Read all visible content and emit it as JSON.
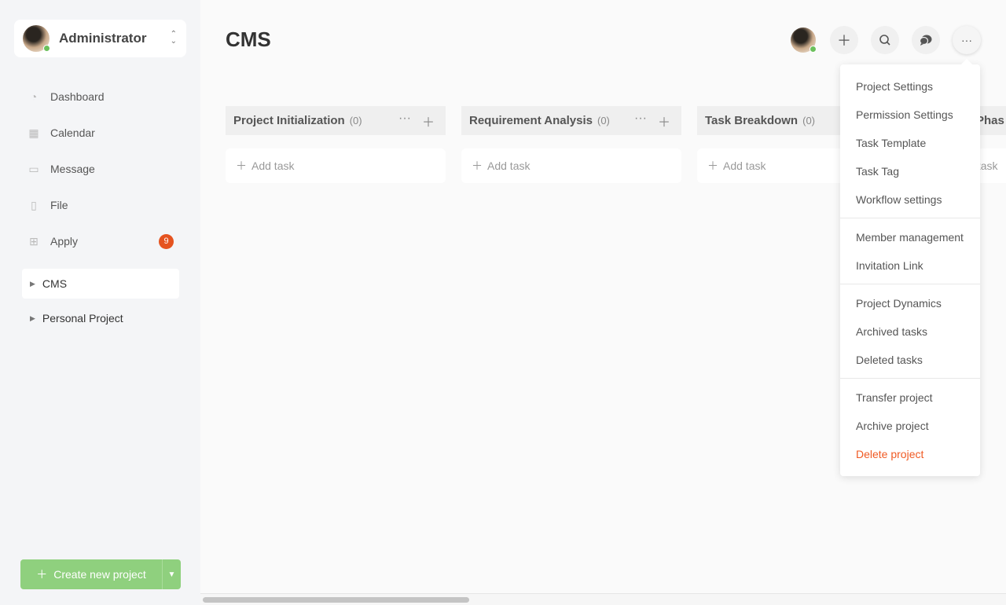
{
  "user": {
    "name": "Administrator",
    "status_color": "#6cc05c"
  },
  "nav": [
    {
      "label": "Dashboard",
      "icon": "dashboard-icon"
    },
    {
      "label": "Calendar",
      "icon": "calendar-icon"
    },
    {
      "label": "Message",
      "icon": "message-icon"
    },
    {
      "label": "File",
      "icon": "file-icon"
    },
    {
      "label": "Apply",
      "icon": "apps-icon",
      "badge": "9"
    }
  ],
  "projects": [
    {
      "label": "CMS",
      "active": true
    },
    {
      "label": "Personal Project",
      "active": false
    }
  ],
  "create_label": "Create new project",
  "page_title": "CMS",
  "columns": [
    {
      "title": "Project Initialization",
      "count": "(0)",
      "add": "Add task"
    },
    {
      "title": "Requirement Analysis",
      "count": "(0)",
      "add": "Add task"
    },
    {
      "title": "Task Breakdown",
      "count": "(0)",
      "add": "Add task"
    },
    {
      "title": "Phas",
      "count": "",
      "add": "Add task"
    }
  ],
  "menu": {
    "items": [
      "Project Settings",
      "Permission Settings",
      "Task Template",
      "Task Tag",
      "Workflow settings",
      "Member management",
      "Invitation Link",
      "Project Dynamics",
      "Archived tasks",
      "Deleted tasks",
      "Transfer project",
      "Archive project",
      "Delete project"
    ],
    "danger_color": "#f05a23"
  },
  "colors": {
    "accent": "#8fd07e",
    "badge": "#e5531f"
  }
}
